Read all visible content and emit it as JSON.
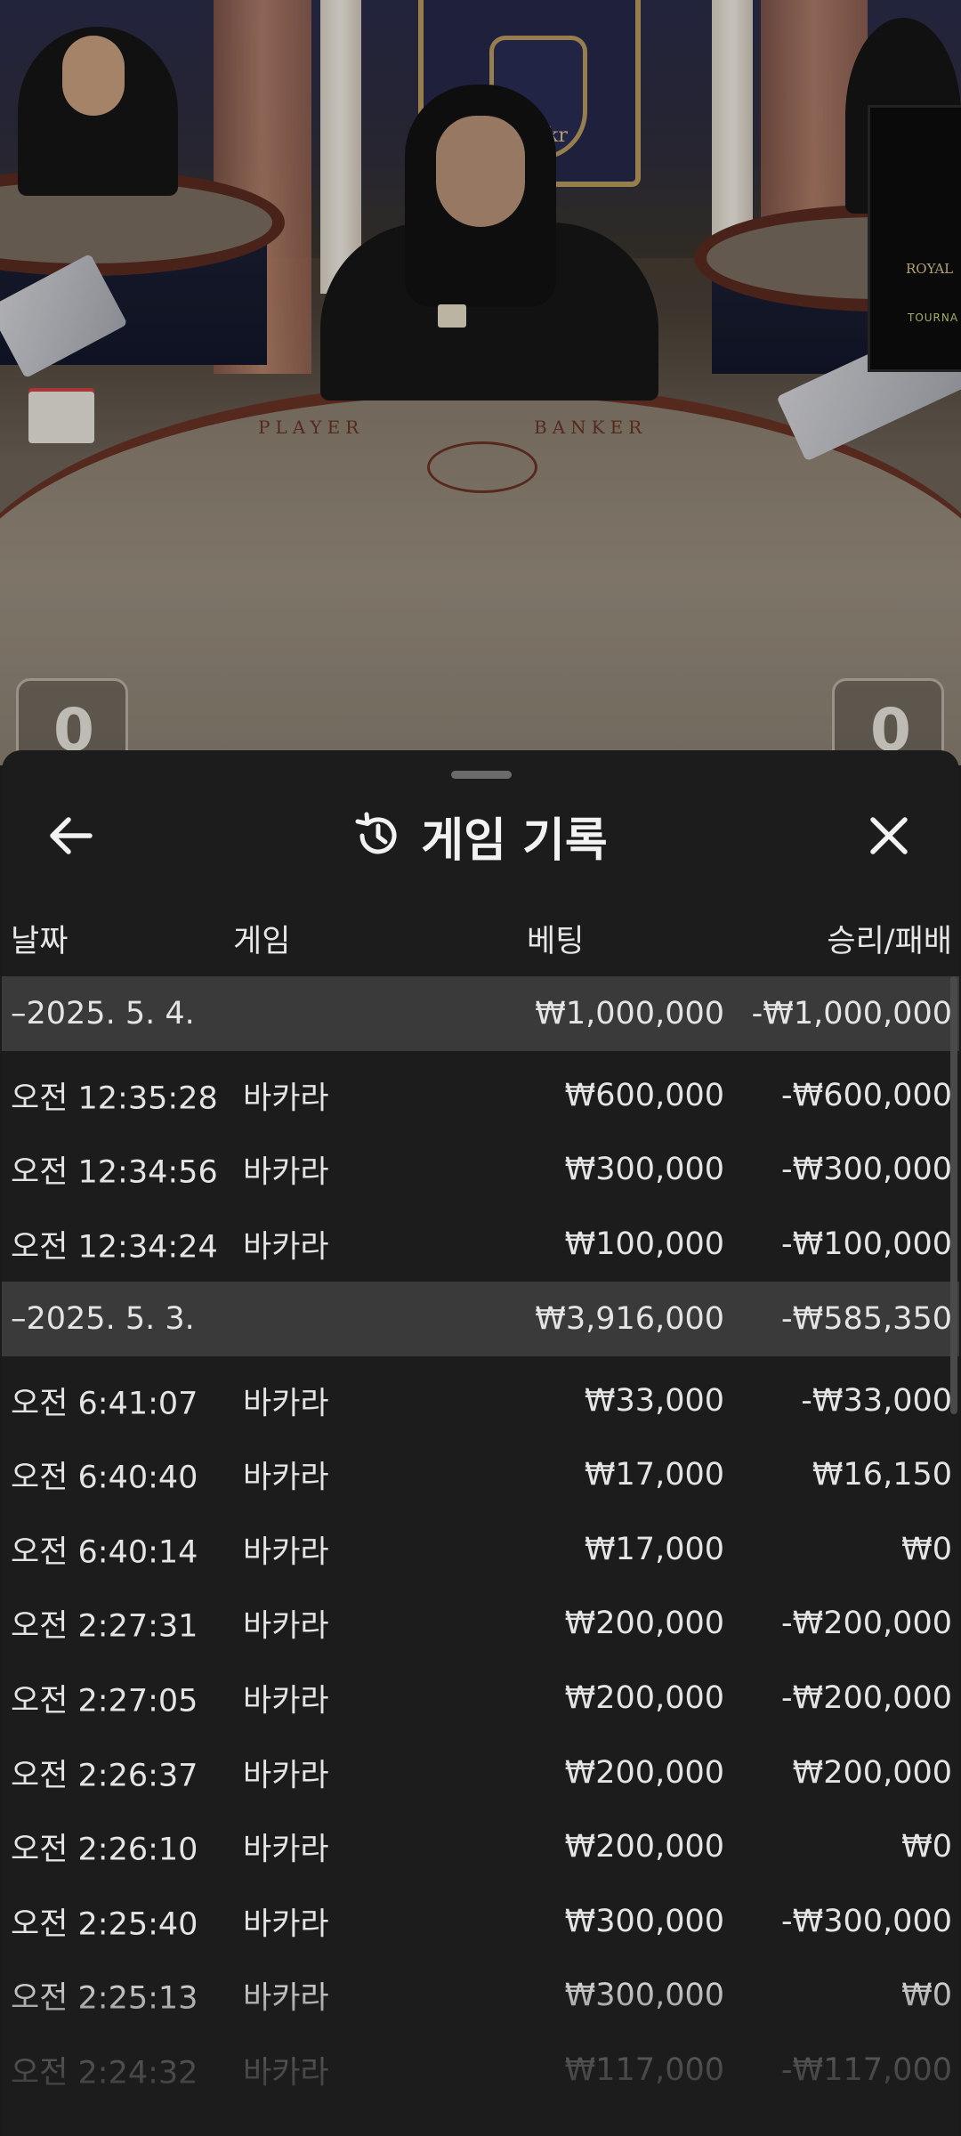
{
  "video": {
    "table_labels": {
      "player": "PLAYER",
      "banker": "BANKER"
    },
    "crest_text": "l.kr",
    "player_score": "0",
    "banker_score": "0",
    "sign_text": "ROYAL",
    "sign_subtext": "TOURNA"
  },
  "sheet": {
    "title": "게임 기록",
    "icons": {
      "back": "arrow-left-icon",
      "title": "history-icon",
      "close": "close-icon"
    }
  },
  "columns": {
    "date": "날짜",
    "game": "게임",
    "bet": "베팅",
    "result": "승리/패배"
  },
  "groups": [
    {
      "date": "–2025. 5. 4.",
      "bet_total": "₩1,000,000",
      "result_total": "-₩1,000,000",
      "rows": [
        {
          "time": "오전 12:35:28",
          "game": "바카라",
          "bet": "₩600,000",
          "result": "-₩600,000"
        },
        {
          "time": "오전 12:34:56",
          "game": "바카라",
          "bet": "₩300,000",
          "result": "-₩300,000"
        },
        {
          "time": "오전 12:34:24",
          "game": "바카라",
          "bet": "₩100,000",
          "result": "-₩100,000"
        }
      ]
    },
    {
      "date": "–2025. 5. 3.",
      "bet_total": "₩3,916,000",
      "result_total": "-₩585,350",
      "rows": [
        {
          "time": "오전 6:41:07",
          "game": "바카라",
          "bet": "₩33,000",
          "result": "-₩33,000"
        },
        {
          "time": "오전 6:40:40",
          "game": "바카라",
          "bet": "₩17,000",
          "result": "₩16,150"
        },
        {
          "time": "오전 6:40:14",
          "game": "바카라",
          "bet": "₩17,000",
          "result": "₩0"
        },
        {
          "time": "오전 2:27:31",
          "game": "바카라",
          "bet": "₩200,000",
          "result": "-₩200,000"
        },
        {
          "time": "오전 2:27:05",
          "game": "바카라",
          "bet": "₩200,000",
          "result": "-₩200,000"
        },
        {
          "time": "오전 2:26:37",
          "game": "바카라",
          "bet": "₩200,000",
          "result": "₩200,000"
        },
        {
          "time": "오전 2:26:10",
          "game": "바카라",
          "bet": "₩200,000",
          "result": "₩0"
        },
        {
          "time": "오전 2:25:40",
          "game": "바카라",
          "bet": "₩300,000",
          "result": "-₩300,000"
        },
        {
          "time": "오전 2:25:13",
          "game": "바카라",
          "bet": "₩300,000",
          "result": "₩0"
        },
        {
          "time": "오전 2:24:32",
          "game": "바카라",
          "bet": "₩117,000",
          "result": "-₩117,000"
        }
      ]
    }
  ]
}
